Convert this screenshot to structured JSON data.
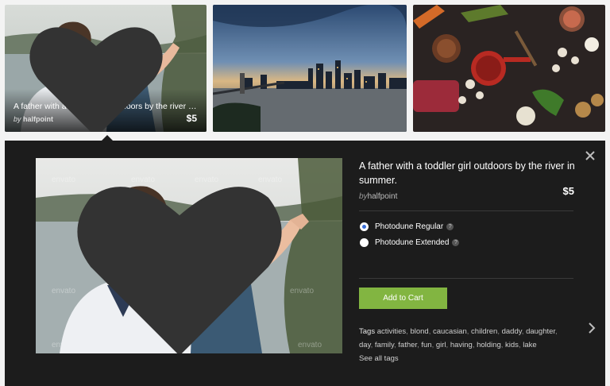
{
  "thumbnails": [
    {
      "title": "A father with a toddler girl outdoors by the river in s...",
      "by": "by",
      "author": "halfpoint",
      "price": "$5",
      "icon": "heart-icon"
    },
    {
      "image": "city-skyline-at-dusk"
    },
    {
      "image": "food-ingredients-flat-lay"
    }
  ],
  "detail": {
    "title": "A father with a toddler girl outdoors by the river in summer.",
    "by": "by",
    "author": "halfpoint",
    "price": "$5",
    "licenses": [
      {
        "label": "Photodune Regular",
        "selected": true,
        "help": "?"
      },
      {
        "label": "Photodune Extended",
        "selected": false,
        "help": "?"
      }
    ],
    "add_to_cart": "Add to Cart",
    "tags_label": "Tags",
    "tags": [
      "activities",
      "blond",
      "caucasian",
      "children",
      "daddy",
      "daughter",
      "day",
      "family",
      "father",
      "fun",
      "girl",
      "having",
      "holding",
      "kids",
      "lake"
    ],
    "see_all": "See all tags",
    "close_icon": "close-icon",
    "next_icon": "chevron-right-icon"
  },
  "colors": {
    "panel_bg": "#1c1c1c",
    "accent_green": "#82b541",
    "radio_selected": "#3a6fd8"
  }
}
